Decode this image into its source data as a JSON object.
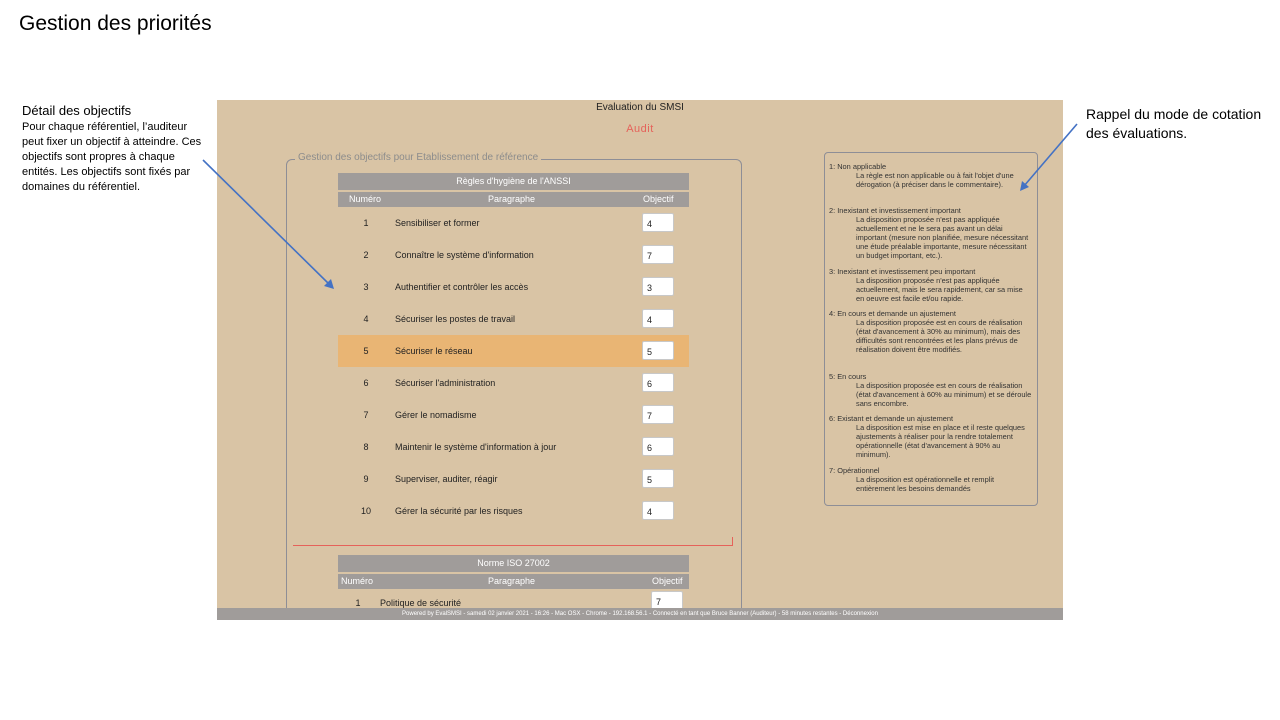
{
  "slide": {
    "title": "Gestion des priorités",
    "left_note_heading": "Détail des objectifs",
    "left_note_body": "Pour chaque référentiel, l’auditeur peut fixer un objectif à atteindre. Ces objectifs sont propres à chaque entités. Les objectifs sont fixés par domaines du référentiel.",
    "right_note": "Rappel du mode de cotation des évaluations."
  },
  "app": {
    "title": "Evaluation du SMSI",
    "subtitle": "Audit",
    "fieldset_legend": "Gestion des objectifs pour Etablissement de référence",
    "table1": {
      "title": "Règles d'hygiène de l'ANSSI",
      "col_num": "Numéro",
      "col_par": "Paragraphe",
      "col_obj": "Objectif",
      "rows": [
        {
          "num": "1",
          "par": "Sensibiliser et former",
          "obj": "4"
        },
        {
          "num": "2",
          "par": "Connaître le système d'information",
          "obj": "7"
        },
        {
          "num": "3",
          "par": "Authentifier et contrôler les accès",
          "obj": "3"
        },
        {
          "num": "4",
          "par": "Sécuriser les postes de travail",
          "obj": "4"
        },
        {
          "num": "5",
          "par": "Sécuriser le réseau",
          "obj": "5"
        },
        {
          "num": "6",
          "par": "Sécuriser l'administration",
          "obj": "6"
        },
        {
          "num": "7",
          "par": "Gérer le nomadisme",
          "obj": "7"
        },
        {
          "num": "8",
          "par": "Maintenir le système d'information à jour",
          "obj": "6"
        },
        {
          "num": "9",
          "par": "Superviser, auditer, réagir",
          "obj": "5"
        },
        {
          "num": "10",
          "par": "Gérer la sécurité par les risques",
          "obj": "4"
        }
      ]
    },
    "table2": {
      "title": "Norme ISO 27002",
      "col_num": "Numéro",
      "col_par": "Paragraphe",
      "col_obj": "Objectif",
      "rows": [
        {
          "num": "1",
          "par": "Politique de sécurité",
          "obj": "7"
        }
      ]
    },
    "legend_items": [
      {
        "title": "1: Non applicable",
        "desc": "La règle est non applicable ou à fait l'objet d'une dérogation (à préciser dans le commentaire)."
      },
      {
        "title": "2: Inexistant et investissement important",
        "desc": "La disposition proposée n'est pas appliquée actuellement et ne le sera pas avant un délai important (mesure non planifiée, mesure nécessitant une étude préalable importante, mesure nécessitant un budget important, etc.)."
      },
      {
        "title": "3: Inexistant et investissement peu important",
        "desc": "La disposition proposée n'est pas appliquée actuellement, mais le sera rapidement, car sa mise en oeuvre est facile et/ou rapide."
      },
      {
        "title": "4: En cours et demande un ajustement",
        "desc": "La disposition proposée est en cours de réalisation (état d'avancement à 30% au minimum), mais des difficultés sont rencontrées et les plans prévus de réalisation doivent être modifiés."
      },
      {
        "title": "5: En cours",
        "desc": "La disposition proposée est en cours de réalisation (état d'avancement à 60% au minimum) et se déroule sans encombre."
      },
      {
        "title": "6: Existant et demande un ajustement",
        "desc": "La disposition est mise en place et il reste quelques ajustements à réaliser pour la rendre totalement opérationnelle (état d'avancement à 90% au minimum)."
      },
      {
        "title": "7: Opérationnel",
        "desc": "La disposition est opérationnelle et remplit entièrement les besoins demandés"
      }
    ],
    "footer": "Powered by EvalSMSI - samedi 02 janvier 2021 - 16:26 - Mac OSX - Chrome - 192.168.56.1 - Connecté en tant que Bruce Banner (Auditeur) - 58 minutes restantes - Déconnexion"
  },
  "colors": {
    "app_background": "#d9c4a5",
    "header_gray": "#a09c9a",
    "selected_row": "#e9b574",
    "accent_red": "#e5625a",
    "arrow_blue": "#4472c4"
  }
}
